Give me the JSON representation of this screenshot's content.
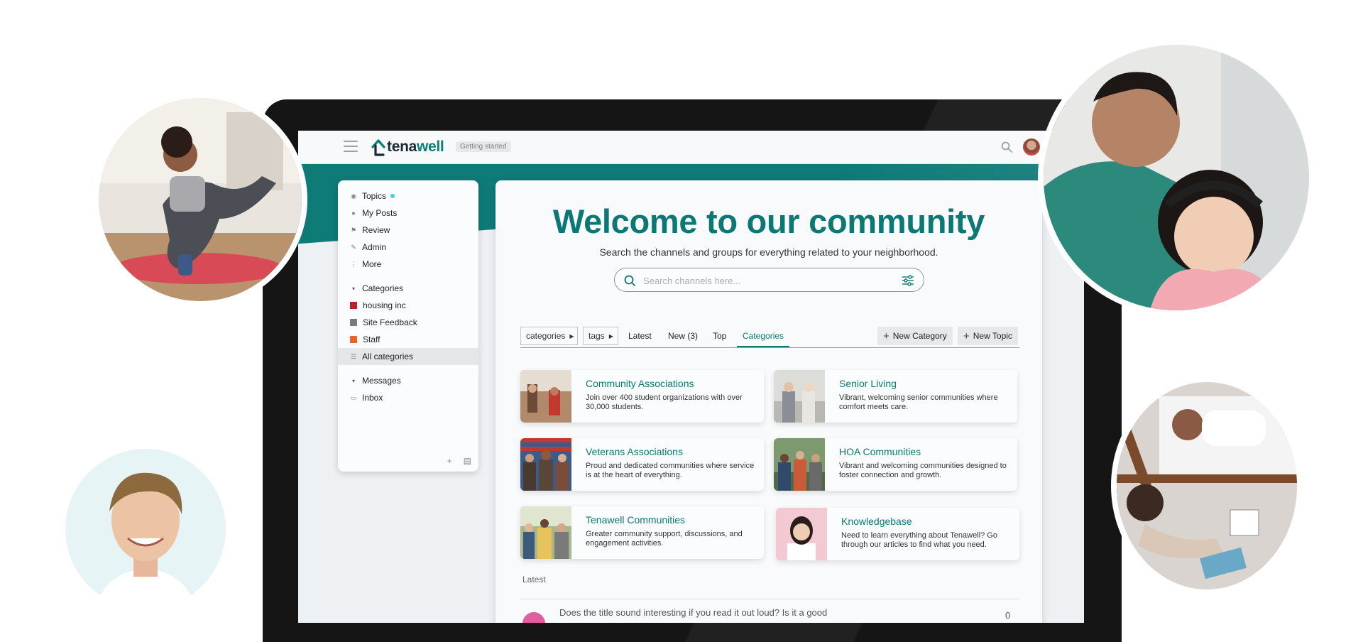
{
  "header": {
    "logo_prefix": "tena",
    "logo_suffix": "well",
    "badge": "Getting started"
  },
  "sidebar": {
    "items": [
      {
        "label": "Topics",
        "icon": "layers-icon"
      },
      {
        "label": "My Posts",
        "icon": "user-icon"
      },
      {
        "label": "Review",
        "icon": "flag-icon"
      },
      {
        "label": "Admin",
        "icon": "wrench-icon"
      },
      {
        "label": "More",
        "icon": "vertical-dots-icon"
      }
    ],
    "categories_header": "Categories",
    "categories": [
      {
        "label": "housing inc",
        "color": "#b8222e"
      },
      {
        "label": "Site Feedback",
        "color": "#7a7a7a"
      },
      {
        "label": "Staff",
        "color": "#e8642c"
      },
      {
        "label": "All categories",
        "icon": "list-icon"
      }
    ],
    "messages_header": "Messages",
    "messages": [
      {
        "label": "Inbox",
        "icon": "inbox-icon"
      }
    ]
  },
  "main": {
    "welcome_title": "Welcome to our community",
    "subtitle": "Search the channels and groups for everything related to your neighborhood.",
    "search_placeholder": "Search channels here...",
    "nav": {
      "categories_dd": "categories",
      "tags_dd": "tags",
      "latest": "Latest",
      "new": "New (3)",
      "top": "Top",
      "categories_tab": "Categories",
      "new_category_btn": "New Category",
      "new_topic_btn": "New Topic"
    },
    "tiles": [
      {
        "title": "Community Associations",
        "desc": "Join over 400 student organizations with over 30,000 students."
      },
      {
        "title": "Senior Living",
        "desc": "Vibrant, welcoming senior communities where comfort meets care."
      },
      {
        "title": "Veterans Associations",
        "desc": "Proud and dedicated communities where service is at the heart of everything."
      },
      {
        "title": "HOA Communities",
        "desc": "Vibrant and welcoming communities designed to foster connection and growth."
      },
      {
        "title": "Tenawell Communities",
        "desc": "Greater community support, discussions, and engagement activities."
      },
      {
        "title": "Knowledgebase",
        "desc": "Need to learn everything about Tenawell? Go through our articles to find what you need."
      }
    ],
    "latest_label": "Latest",
    "latest_topic": {
      "title": "Does the title sound interesting if you read it out loud? Is it a good",
      "count": "0"
    }
  },
  "colors": {
    "teal": "#0b7873",
    "band": "#0e7b77"
  }
}
